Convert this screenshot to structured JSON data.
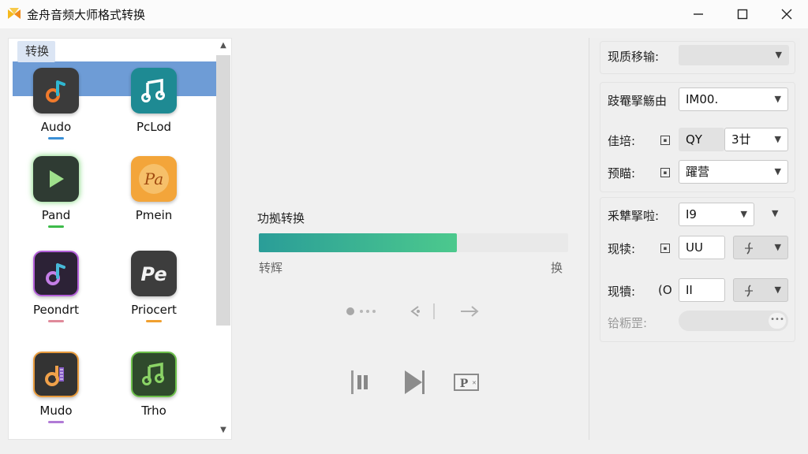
{
  "window": {
    "title": "金舟音频大师格式转换",
    "logo_icon": "app-logo-icon",
    "controls": [
      "minimize-icon",
      "maximize-icon",
      "close-icon"
    ]
  },
  "left_panel": {
    "tab": "转换",
    "formats": [
      {
        "label": "Audo",
        "icon": "music-note-icon",
        "bg": "#3b3b3b",
        "accent": "#f07a2c",
        "under": "#3a8fd6"
      },
      {
        "label": "PcLod",
        "icon": "music-notes-icon",
        "bg": "#1e8a93",
        "accent": "#ffffff",
        "under": "#cccccc"
      },
      {
        "label": "Pand",
        "icon": "play-icon",
        "bg": "#2f3b33",
        "accent": "#9fe08c",
        "under": "#3dbb4a"
      },
      {
        "label": "Pmein",
        "icon": "pa-icon",
        "bg": "#f3a53a",
        "accent": "#ffffff",
        "under": "#cccccc"
      },
      {
        "label": "Peondrt",
        "icon": "music-note-purple-icon",
        "bg": "#2c2236",
        "accent": "#c47ee6",
        "under": "#e08a9a"
      },
      {
        "label": "Priocert",
        "icon": "pe-icon",
        "bg": "#3d3d3d",
        "accent": "#f2f2f2",
        "under": "#f0a030"
      },
      {
        "label": "Mudo",
        "icon": "music-note-orange-icon",
        "bg": "#333333",
        "accent": "#f0a14a",
        "under": "#b07ad6"
      },
      {
        "label": "Trho",
        "icon": "music-notes-green-icon",
        "bg": "#2f4a2c",
        "accent": "#8bd466",
        "under": "#cccccc"
      }
    ]
  },
  "center": {
    "progress_title": "功拠转换",
    "progress_percent": 64,
    "progress_left": "转辉",
    "progress_right": "换",
    "controls_row1": [
      "dots-icon",
      "share-icon",
      "forward-arrow-icon"
    ],
    "controls_row2": [
      "pause-icon",
      "play-next-icon",
      "preview-icon"
    ]
  },
  "right_panel": {
    "row1": {
      "label": "现质移输:",
      "value": ""
    },
    "row2": {
      "label": "跂罨掔觞由",
      "value": "IM00."
    },
    "row3": {
      "label": "佳培:",
      "left_value": "QY",
      "right_value": "3廿"
    },
    "row4": {
      "label": "预瞄:",
      "value": "躍营"
    },
    "row5": {
      "label": "釆犨掔啦:",
      "value": "I9"
    },
    "row6": {
      "label": "现犊:",
      "value": "UU"
    },
    "row7": {
      "label": "现犢:",
      "prefix": "(O",
      "value": "II"
    },
    "row8": {
      "label": "铪粝罡:",
      "value": ""
    }
  }
}
